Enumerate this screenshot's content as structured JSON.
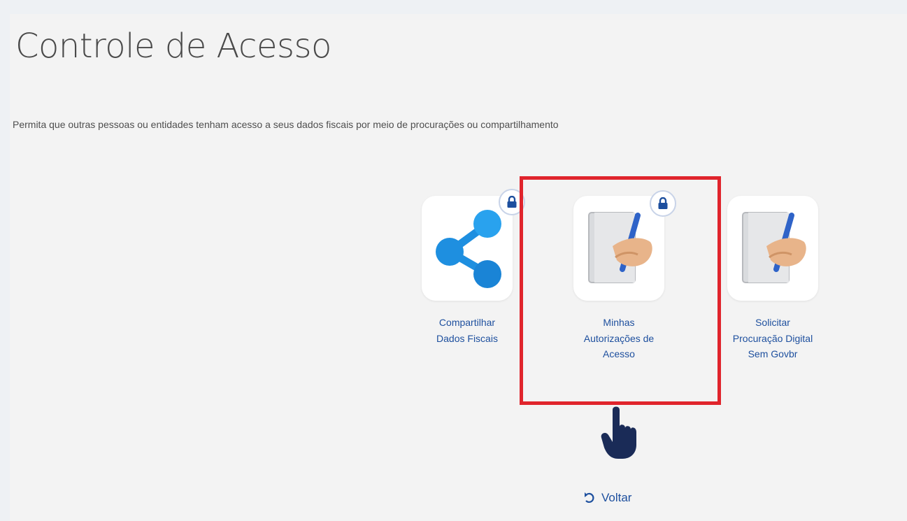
{
  "page": {
    "title": "Controle de Acesso",
    "subtitle": "Permita que outras pessoas ou entidades tenham acesso a seus dados fiscais por meio de procurações ou compartilhamento"
  },
  "tiles": [
    {
      "label_line1": "Compartilhar",
      "label_line2": "Dados Fiscais",
      "icon": "share-icon",
      "locked": true
    },
    {
      "label_line1": "Minhas",
      "label_line2": "Autorizações de",
      "label_line3": "Acesso",
      "icon": "signing-document-icon",
      "locked": true,
      "highlighted": true
    },
    {
      "label_line1": "Solicitar",
      "label_line2": "Procuração Digital",
      "label_line3": "Sem Govbr",
      "icon": "signing-document-icon",
      "locked": false
    }
  ],
  "back": {
    "label": "Voltar",
    "icon": "undo-arrow-icon"
  },
  "colors": {
    "link": "#1d4f9e",
    "highlight": "#e0242c",
    "share_icon": "#1e8fe0",
    "cursor": "#1a2b57"
  }
}
